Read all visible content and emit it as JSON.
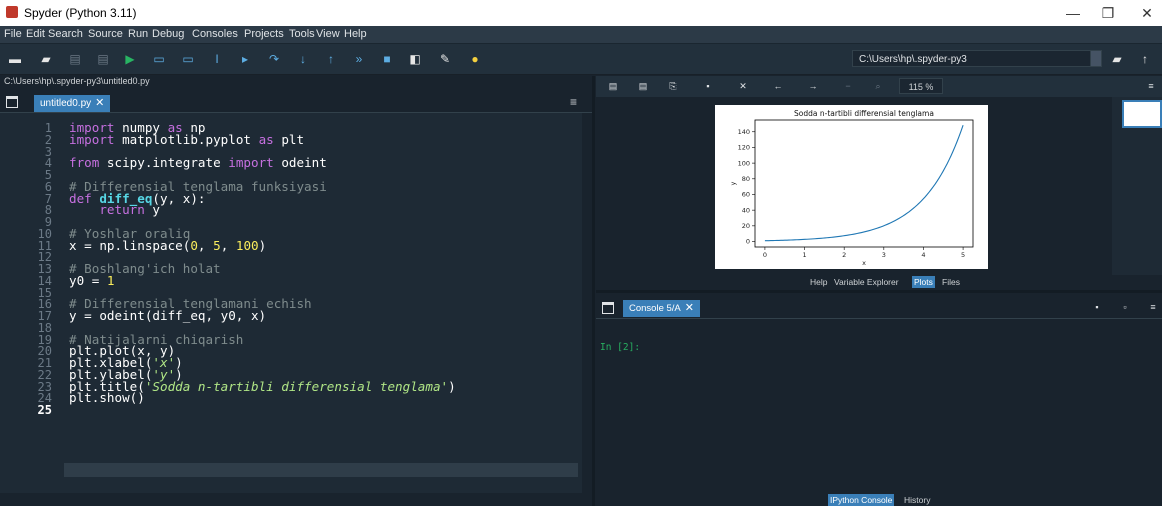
{
  "window": {
    "title": "Spyder (Python 3.11)"
  },
  "menubar": {
    "items": [
      "File",
      "Edit",
      "Search",
      "Source",
      "Run",
      "Debug",
      "Consoles",
      "Projects",
      "Tools",
      "View",
      "Help"
    ]
  },
  "toolbar": {
    "icons": [
      "new-file-icon",
      "open-file-icon",
      "save-icon",
      "save-all-icon",
      "run-icon",
      "run-cell-icon",
      "run-cell-advance-icon",
      "run-selection-icon",
      "debug-icon",
      "step-icon",
      "step-into-icon",
      "step-return-icon",
      "continue-icon",
      "stop-debug-icon",
      "maximize-pane-icon",
      "preferences-icon",
      "python-path-icon"
    ],
    "working_dir": "C:\\Users\\hp\\.spyder-py3"
  },
  "editor": {
    "path": "C:\\Users\\hp\\.spyder-py3\\untitled0.py",
    "tab_label": "untitled0.py",
    "current_line": 25,
    "lines": [
      "import numpy as np",
      "import matplotlib.pyplot as plt",
      "",
      "from scipy.integrate import odeint",
      "",
      "# Differensial tenglama funksiyasi",
      "def diff_eq(y, x):",
      "    return y",
      "",
      "# Yoshlar oraliq",
      "x = np.linspace(0, 5, 100)",
      "",
      "# Boshlang'ich holat",
      "y0 = 1",
      "",
      "# Differensial tenglamani echish",
      "y = odeint(diff_eq, y0, x)",
      "",
      "# Natijalarni chiqarish",
      "plt.plot(x, y)",
      "plt.xlabel('x')",
      "plt.ylabel('y')",
      "plt.title('Sodda n-tartibli differensial tenglama')",
      "plt.show()",
      ""
    ]
  },
  "plots": {
    "zoom": "115 %",
    "tabs": [
      "Help",
      "Variable Explorer",
      "Plots",
      "Files"
    ],
    "active_tab": "Plots"
  },
  "chart_data": {
    "type": "line",
    "title": "Sodda n-tartibli differensial tenglama",
    "xlabel": "x",
    "ylabel": "y",
    "xlim": [
      -0.25,
      5.25
    ],
    "ylim": [
      -7,
      155
    ],
    "xticks": [
      0,
      1,
      2,
      3,
      4,
      5
    ],
    "yticks": [
      0,
      20,
      40,
      60,
      80,
      100,
      120,
      140
    ],
    "series": [
      {
        "function": "exp(x)",
        "x_range": [
          0,
          5
        ],
        "points": 100,
        "color": "#1f77b4"
      }
    ]
  },
  "console": {
    "tab_label": "Console 5/A",
    "prompt": "In [2]:",
    "tabs": [
      "IPython Console",
      "History"
    ],
    "active_tab": "IPython Console"
  },
  "colors": {
    "accent": "#3a7fb8",
    "background": "#19232d",
    "editor_bg": "#1e2a35"
  }
}
